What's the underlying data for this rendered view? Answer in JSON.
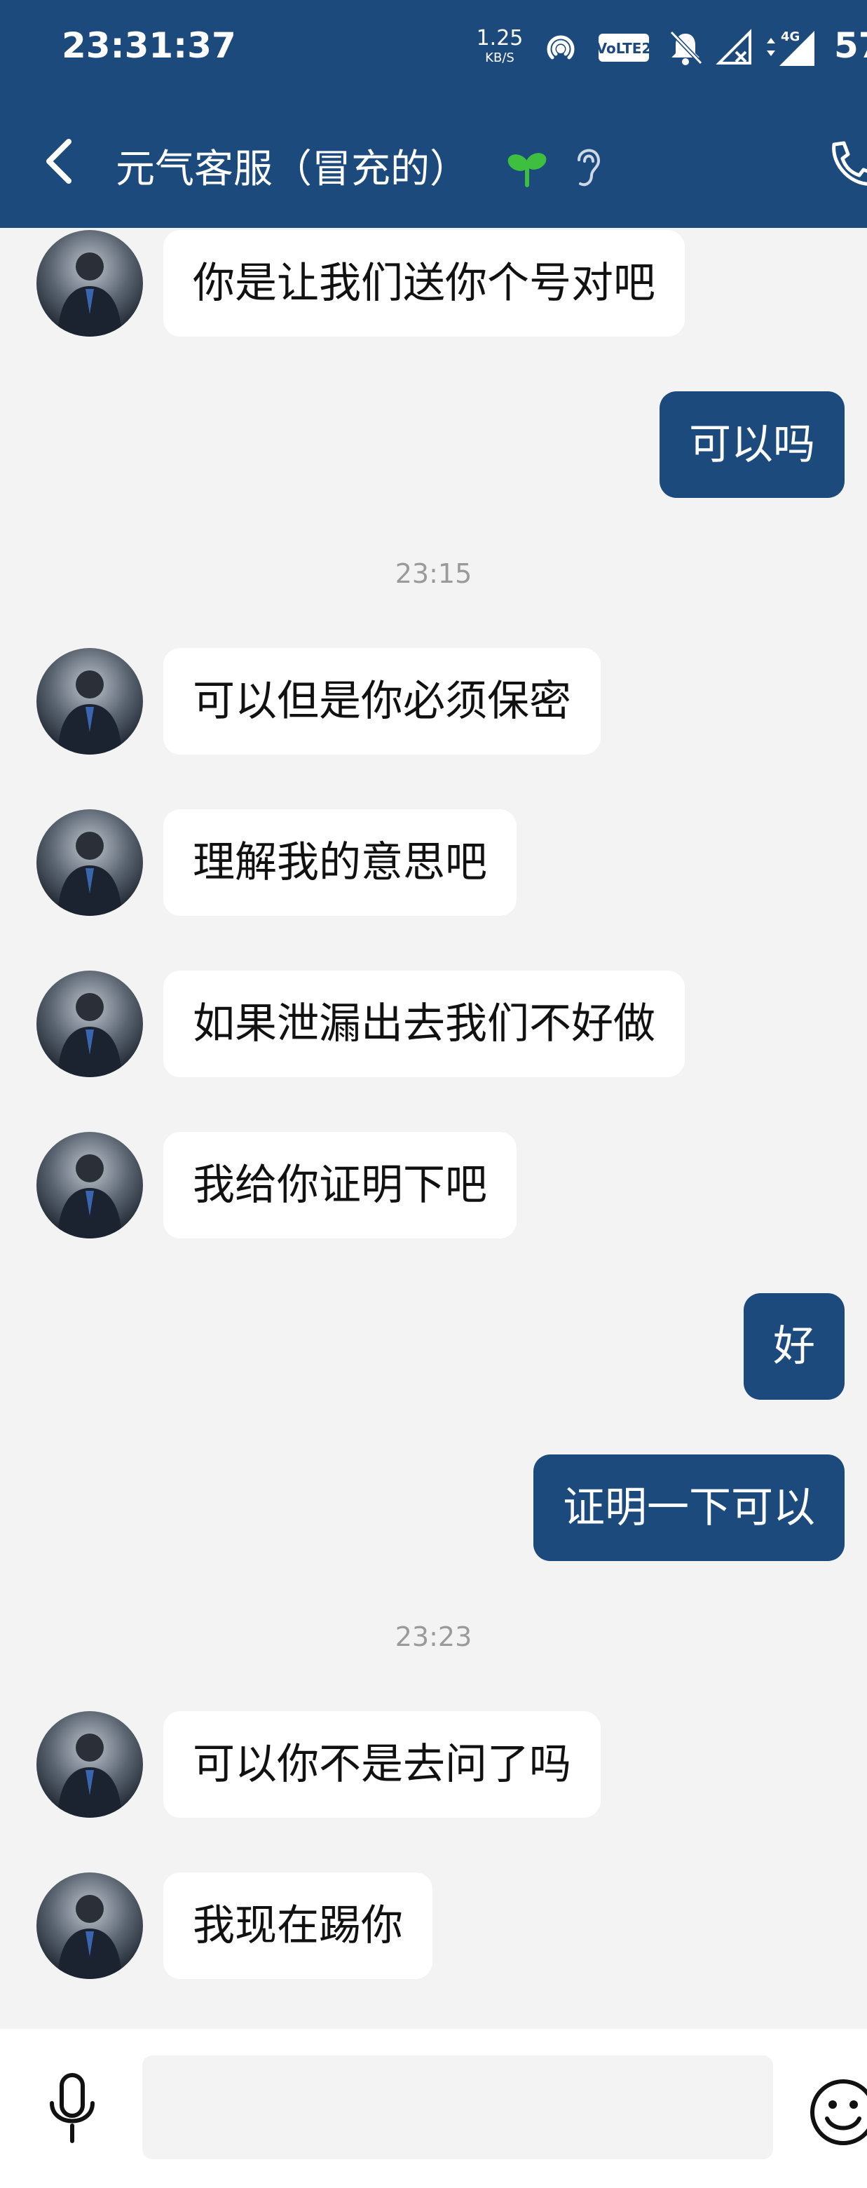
{
  "status_bar": {
    "time": "23:31:37",
    "net_speed_value": "1.25",
    "net_speed_unit": "KB/S",
    "volte_label": "VoLTE 2",
    "signal_label": "4G",
    "battery": "57",
    "icons": [
      "hotspot-icon",
      "volte-icon",
      "mute-bell-icon",
      "signal-x-icon",
      "signal-4g-icon"
    ]
  },
  "header": {
    "title": "元气客服（冒充的）",
    "icons": [
      "back-arrow-icon",
      "sprout-icon",
      "ear-icon",
      "phone-icon"
    ]
  },
  "colors": {
    "header_bg": "#1c4a7c",
    "outgoing_bubble": "#1c4a7c",
    "incoming_bubble": "#ffffff",
    "chat_bg": "#f3f3f3",
    "sprout": "#3fbf3f"
  },
  "messages": [
    {
      "type": "in",
      "text": "你是让我们送你个号对吧"
    },
    {
      "type": "out",
      "text": "可以吗"
    },
    {
      "type": "time",
      "text": "23:15"
    },
    {
      "type": "in",
      "text": "可以但是你必须保密"
    },
    {
      "type": "in",
      "text": "理解我的意思吧"
    },
    {
      "type": "in",
      "text": "如果泄漏出去我们不好做"
    },
    {
      "type": "in",
      "text": "我给你证明下吧"
    },
    {
      "type": "out",
      "text": "好"
    },
    {
      "type": "out",
      "text": "证明一下可以"
    },
    {
      "type": "time",
      "text": "23:23"
    },
    {
      "type": "in",
      "text": "可以你不是去问了吗"
    },
    {
      "type": "in",
      "text": "我现在踢你"
    }
  ],
  "input_bar": {
    "placeholder": "",
    "icons": [
      "microphone-icon",
      "emoji-icon"
    ]
  }
}
